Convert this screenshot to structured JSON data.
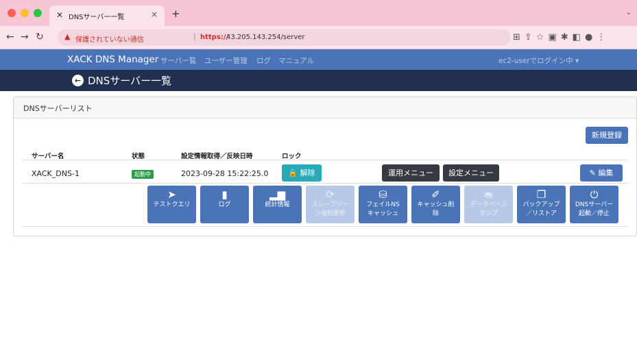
{
  "browser": {
    "tab_title": "DNSサーバー一覧",
    "tab_favicon": "✕",
    "tab_close": "×",
    "new_tab": "+",
    "address": {
      "insecure_label": "保護されていない通信",
      "separator": "|",
      "scheme": "https://",
      "url_rest": "43.205.143.254/server"
    }
  },
  "navbar": {
    "brand": "XACK DNS Manager",
    "links": [
      "サーバー覧",
      "ユーザー管理",
      "ログ",
      "マニュアル"
    ],
    "user": "ec2-userでログイン中 ▾"
  },
  "page": {
    "title": "DNSサーバー一覧"
  },
  "card": {
    "header": "DNSサーバーリスト",
    "new_button": "新規登録",
    "columns": [
      "サーバー名",
      "状態",
      "設定情報取得／反映日時",
      "ロック"
    ],
    "row": {
      "name": "XACK_DNS-1",
      "status": "起動中",
      "datetime": "2023-09-28 15:22:25.0",
      "unlock_label": "解除",
      "ops_menu": "運用メニュー",
      "settings_menu": "設定メニュー",
      "edit_label": "編集"
    },
    "actions": [
      {
        "line1": "テストクエリ",
        "line2": "",
        "icon": "send-icon",
        "enabled": true
      },
      {
        "line1": "ログ",
        "line2": "",
        "icon": "book-icon",
        "enabled": true
      },
      {
        "line1": "統計情報",
        "line2": "",
        "icon": "bar-chart-icon",
        "enabled": true
      },
      {
        "line1": "スレーブゾー",
        "line2": "ン強制更新",
        "icon": "sync-icon",
        "enabled": false
      },
      {
        "line1": "フェイルNS",
        "line2": "キャッシュ",
        "icon": "database-icon",
        "enabled": true
      },
      {
        "line1": "キャッシュ削",
        "line2": "除",
        "icon": "broom-icon",
        "enabled": true
      },
      {
        "line1": "データベース",
        "line2": "ダンプ",
        "icon": "dump-icon",
        "enabled": false
      },
      {
        "line1": "バックアップ",
        "line2": "／リストア",
        "icon": "copy-icon",
        "enabled": true
      },
      {
        "line1": "DNSサーバー",
        "line2": "起動／停止",
        "icon": "power-icon",
        "enabled": true
      }
    ]
  }
}
